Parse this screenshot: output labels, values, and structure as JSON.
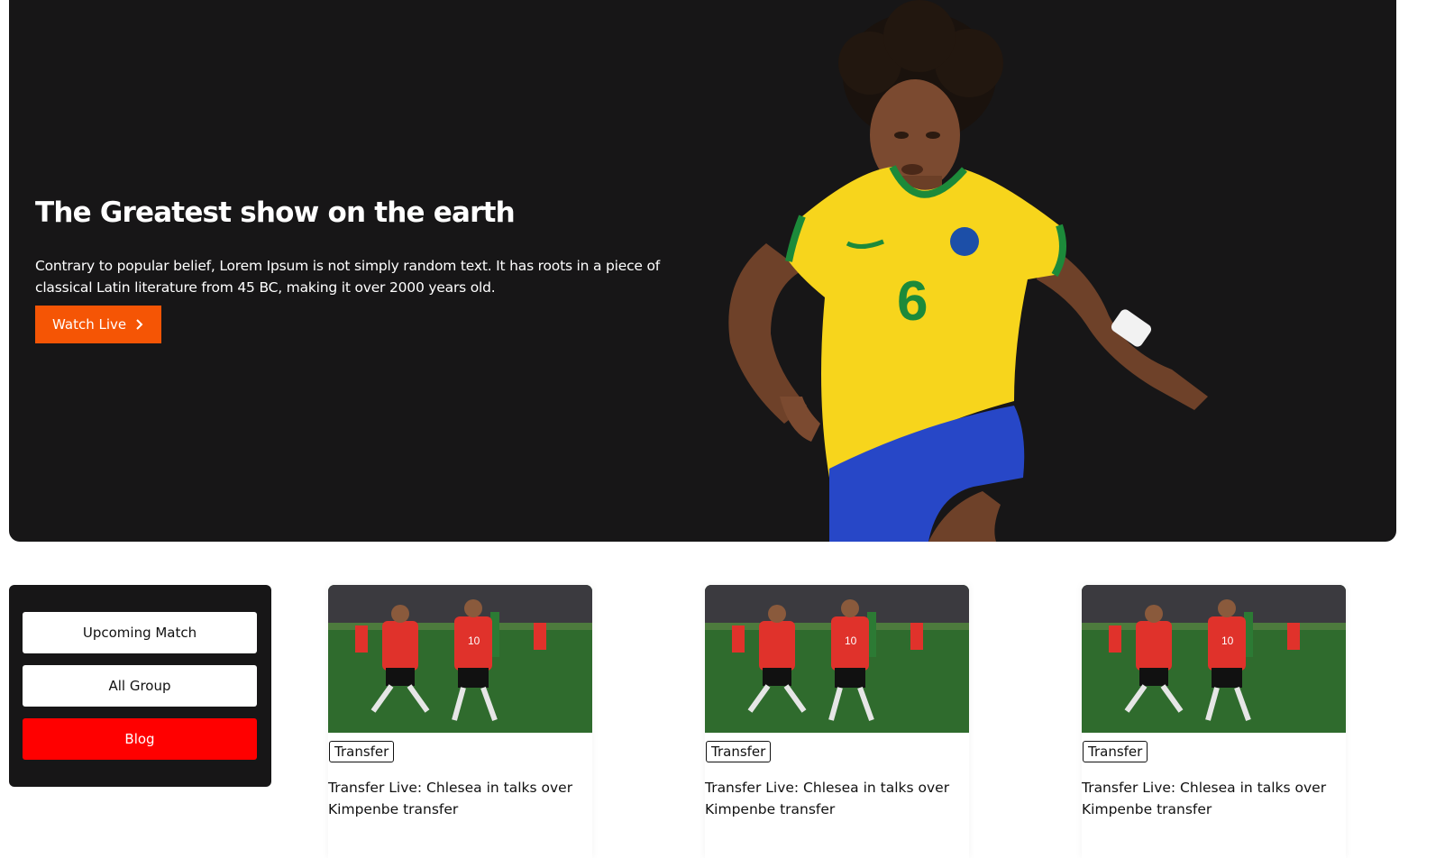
{
  "hero": {
    "title": "The Greatest show on the earth",
    "description": "Contrary to popular belief, Lorem Ipsum is not simply random text. It has roots in a piece of classical Latin literature from 45 BC, making it over 2000 years old.",
    "cta_label": "Watch Live",
    "jersey_number": "6",
    "colors": {
      "background": "#171617",
      "cta": "#f55505",
      "jersey": "#f7d51c",
      "shorts": "#2747c7"
    }
  },
  "sidebar": {
    "items": [
      {
        "label": "Upcoming Match",
        "active": false
      },
      {
        "label": "All Group",
        "active": false
      },
      {
        "label": "Blog",
        "active": true
      }
    ],
    "colors": {
      "panel": "#171617",
      "active": "#ff0000"
    }
  },
  "cards": [
    {
      "tag": "Transfer",
      "title": "Transfer Live: Chlesea in talks over Kimpenbe transfer",
      "image_icon": "football-celebration-photo",
      "shirt_number": "10"
    },
    {
      "tag": "Transfer",
      "title": "Transfer Live: Chlesea in talks over Kimpenbe transfer",
      "image_icon": "football-celebration-photo",
      "shirt_number": "10"
    },
    {
      "tag": "Transfer",
      "title": "Transfer Live: Chlesea in talks over Kimpenbe transfer",
      "image_icon": "football-celebration-photo",
      "shirt_number": "10"
    }
  ]
}
